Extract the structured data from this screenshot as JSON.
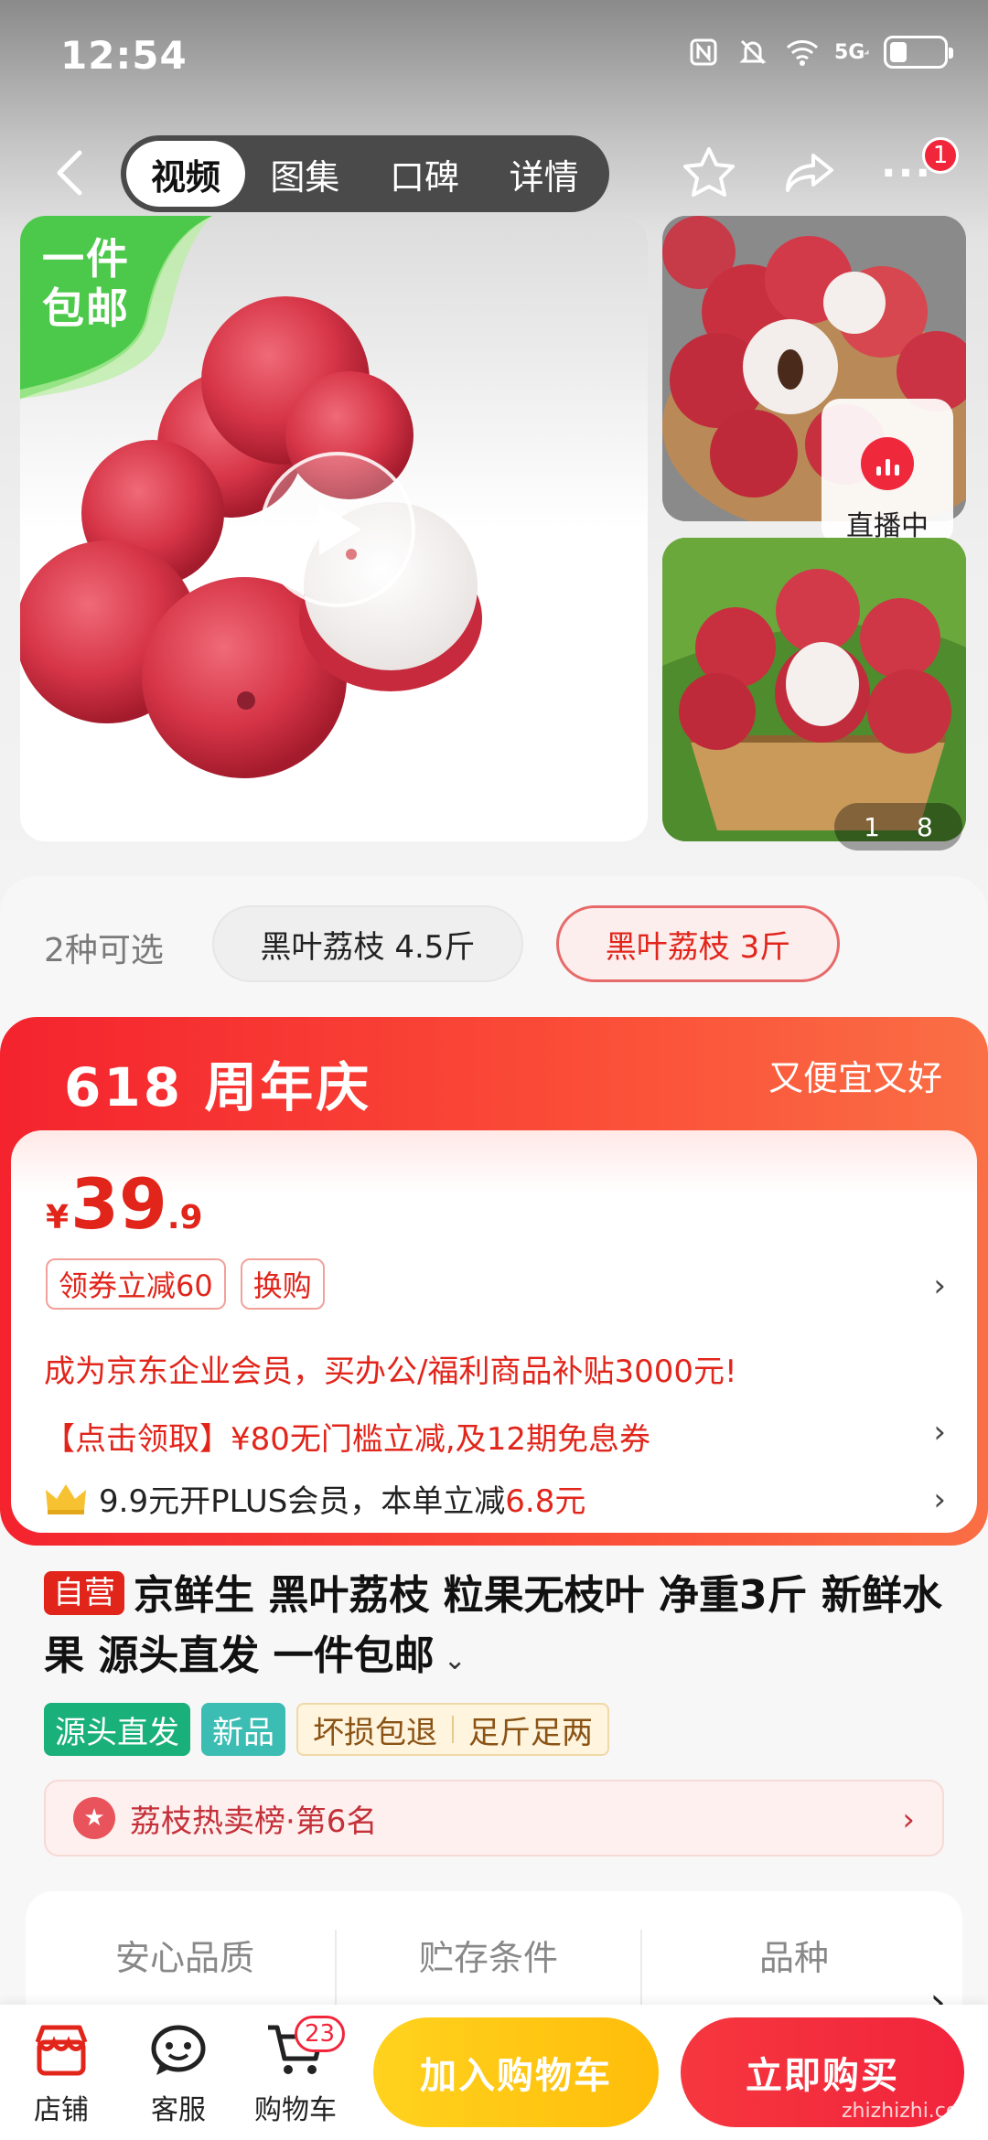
{
  "status_bar": {
    "time": "12:54",
    "network": "5G"
  },
  "nav": {
    "tabs": [
      {
        "label": "视频",
        "active": true
      },
      {
        "label": "图集",
        "active": false
      },
      {
        "label": "口碑",
        "active": false
      },
      {
        "label": "详情",
        "active": false
      }
    ],
    "more_badge": "1"
  },
  "gallery": {
    "promo_corner": "一件包邮",
    "live_label": "直播中",
    "counter_current": "1",
    "counter_total": "8"
  },
  "spec": {
    "count_label": "2种可选",
    "options": [
      "黑叶荔枝 4.5斤",
      "黑叶荔枝 3斤"
    ],
    "selected_index": 1
  },
  "event": {
    "title": "618 周年庆",
    "slogan": "又便宜又好"
  },
  "price": {
    "currency": "¥",
    "integer": "39",
    "decimal": ".9",
    "tags": [
      "领券立减60",
      "换购"
    ],
    "enterprise_line": "成为京东企业会员，买办公/福利商品补贴3000元!",
    "coupon_line": "【点击领取】¥80无门槛立减,及12期免息券",
    "plus_prefix": "9.9元开PLUS会员，本单立减",
    "plus_amount": "6.8元"
  },
  "product": {
    "self_badge": "自营",
    "title": "京鲜生 黑叶荔枝 粒果无枝叶 净重3斤 新鲜水果 源头直发 一件包邮",
    "attributes": [
      "源头直发",
      "新品"
    ],
    "guarantees": [
      "坏损包退",
      "足斤足两"
    ],
    "rank": "荔枝热卖榜·第6名"
  },
  "quality": {
    "columns": [
      "安心品质",
      "贮存条件",
      "品种"
    ]
  },
  "bottom": {
    "store": "店铺",
    "service": "客服",
    "cart": "购物车",
    "cart_count": "23",
    "add_to_cart": "加入购物车",
    "buy_now": "立即购买"
  },
  "watermark": "zhizhizhi.com",
  "colors": {
    "jd_red": "#e1251b",
    "cart_yellow": "#ffc412",
    "promo_green": "#4cc94a"
  }
}
